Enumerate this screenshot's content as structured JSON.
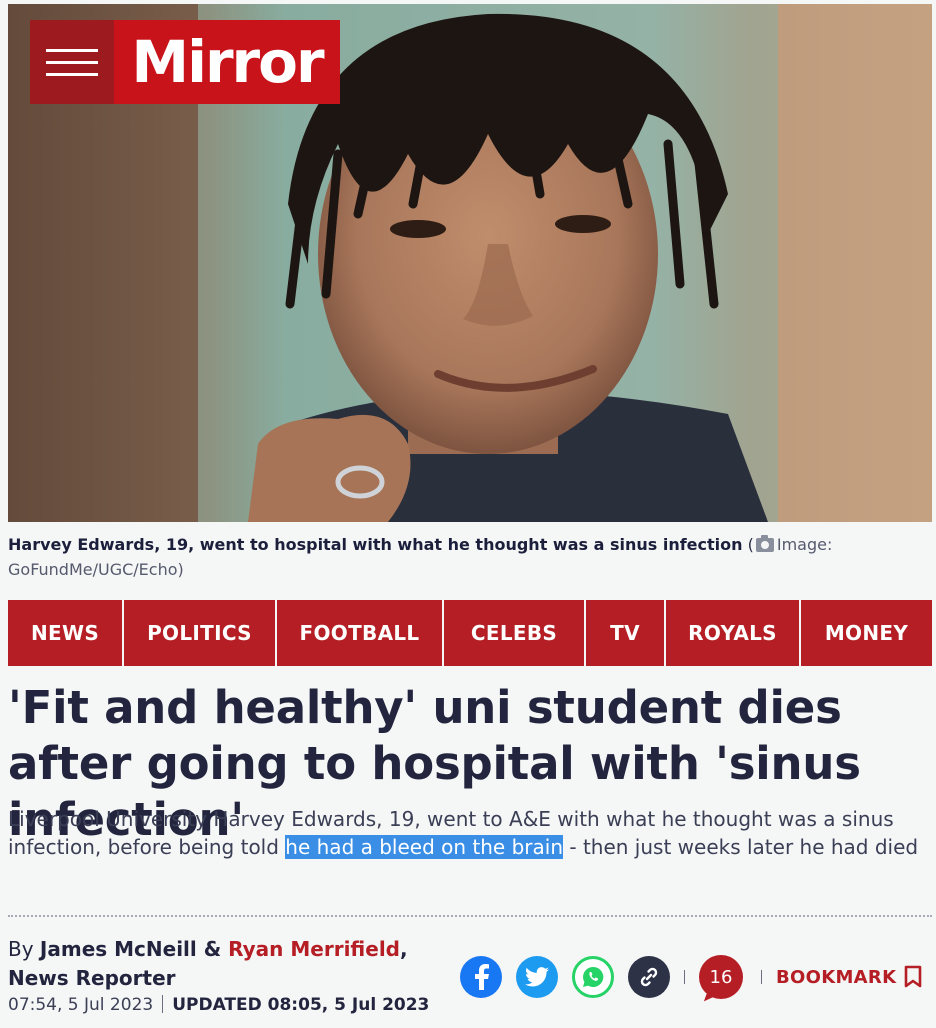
{
  "header": {
    "brand": "Mirror",
    "menu_icon": "hamburger-icon"
  },
  "hero": {
    "caption_bold": "Harvey Edwards, 19, went to hospital with what he thought was a sinus infection",
    "caption_credit_open": " (",
    "caption_credit": "Image: GoFundMe/UGC/Echo)",
    "camera_icon": "camera-icon"
  },
  "nav": {
    "items": [
      "NEWS",
      "POLITICS",
      "FOOTBALL",
      "CELEBS",
      "TV",
      "ROYALS",
      "MONEY"
    ]
  },
  "article": {
    "headline": "'Fit and healthy' uni student dies after going to hospital with 'sinus infection'",
    "standfirst_before": "Liverpool University Harvey Edwards, 19, went to A&E with what he thought was a sinus infection, before being told ",
    "standfirst_highlight": "he had a bleed on the brain",
    "standfirst_after": " - then just weeks later he had died",
    "by": "By ",
    "author1": "James McNeill",
    "amp": " & ",
    "author2": "Ryan Merrifield",
    "role": ", News Reporter",
    "published": "07:54, 5 Jul 2023",
    "updated": "UPDATED 08:05, 5 Jul 2023"
  },
  "share": {
    "icons": [
      "facebook-icon",
      "twitter-icon",
      "whatsapp-icon",
      "link-icon"
    ],
    "comment_count": "16",
    "bookmark_label": "BOOKMARK"
  },
  "colors": {
    "brand_red": "#c8131b",
    "nav_red": "#b41e24",
    "facebook": "#1877f2",
    "twitter": "#1d9bf0",
    "whatsapp": "#25d366",
    "link": "#2e3247"
  }
}
